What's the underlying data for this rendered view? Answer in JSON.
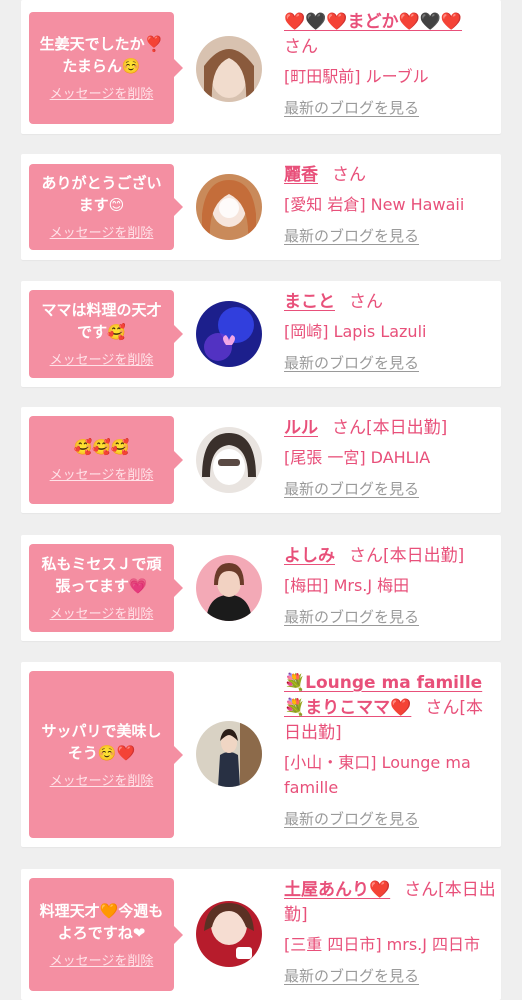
{
  "colors": {
    "background": "#efefef",
    "bubble": "#f48fa2",
    "name_text": "#e8507a",
    "blog_link": "#9a9a9a"
  },
  "delete_label": "メッセージを削除",
  "blog_label": "最新のブログを見る",
  "honorific": "さん",
  "entries": [
    {
      "message": "生姜天でしたか❣️\nたまらん☺️",
      "name": "❤️🖤❤️まどか❤️🖤❤️",
      "suffix": "",
      "shop": "[町田駅前] ルーブル"
    },
    {
      "message": "ありがとうござい\nます😊",
      "name": "麗香",
      "suffix": "",
      "shop": "[愛知 岩倉] New Hawaii"
    },
    {
      "message": "ママは料理の天才\nです🥰",
      "name": "まこと",
      "suffix": "",
      "shop": "[岡崎] Lapis Lazuli"
    },
    {
      "message": "🥰🥰🥰",
      "name": "ルル",
      "suffix": "[本日出勤]",
      "shop": "[尾張 一宮] DAHLIA"
    },
    {
      "message": "私もミセスＪで頑\n張ってます💗",
      "name": "よしみ",
      "suffix": "[本日出勤]",
      "shop": "[梅田] Mrs.J 梅田"
    },
    {
      "message": "サッパリで美味し\nそう☺️❤️",
      "name": "💐Lounge ma famille💐まりこママ❤️",
      "suffix": "[本日出勤]",
      "shop": "[小山・東口] Lounge ma famille"
    },
    {
      "message": "料理天才🧡今週も\nよろですね❤",
      "name": "土屋あんり❤️",
      "suffix": "[本日出勤]",
      "shop": "[三重 四日市] mrs.J 四日市"
    }
  ]
}
